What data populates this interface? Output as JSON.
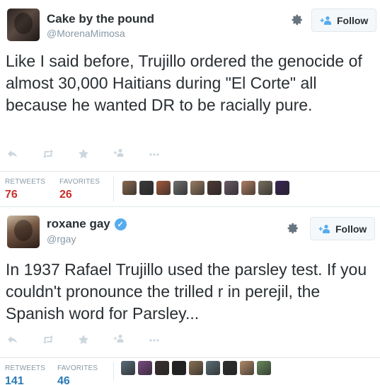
{
  "tweets": [
    {
      "display_name": "Cake by the pound",
      "handle": "@MorenaMimosa",
      "verified": false,
      "follow_label": "Follow",
      "text": "Like I said before, Trujillo ordered the genocide of almost 30,000 Haitians during \"El Corte\" all because he wanted DR to be racially pure.",
      "retweets_label": "RETWEETS",
      "retweets_count": "76",
      "favorites_label": "FAVORITES",
      "favorites_count": "26",
      "favoriter_colors": [
        "#8a6a52",
        "#3b3b3b",
        "#a35a3c",
        "#6f6f6f",
        "#9a7d63",
        "#4f3a37",
        "#6b5a66",
        "#b07f64",
        "#7a6f5f",
        "#3a2455"
      ]
    },
    {
      "display_name": "roxane gay",
      "handle": "@rgay",
      "verified": true,
      "follow_label": "Follow",
      "text": "In 1937 Rafael Trujillo used the parsley test. If you couldn't pronounce the trilled r in perejil, the Spanish word for Parsley...",
      "retweets_label": "RETWEETS",
      "retweets_count": "141",
      "favorites_label": "FAVORITES",
      "favorites_count": "46",
      "favoriter_colors": [
        "#5a6c7a",
        "#7a4a82",
        "#3a3030",
        "#222222",
        "#8a7054",
        "#5c6e78",
        "#2e2e2e",
        "#b08a68",
        "#6a8a5c"
      ]
    }
  ],
  "icons": {
    "gear": "gear-icon",
    "follow": "add-user-icon",
    "reply": "reply-icon",
    "retweet": "retweet-icon",
    "favorite": "star-icon",
    "follow_small": "add-user-icon",
    "more": "more-icon"
  },
  "colors": {
    "follow_blue": "#55acee",
    "tweet1_stat": "#c9302c",
    "tweet2_stat": "#2b7bb9",
    "muted": "#8899a6"
  }
}
